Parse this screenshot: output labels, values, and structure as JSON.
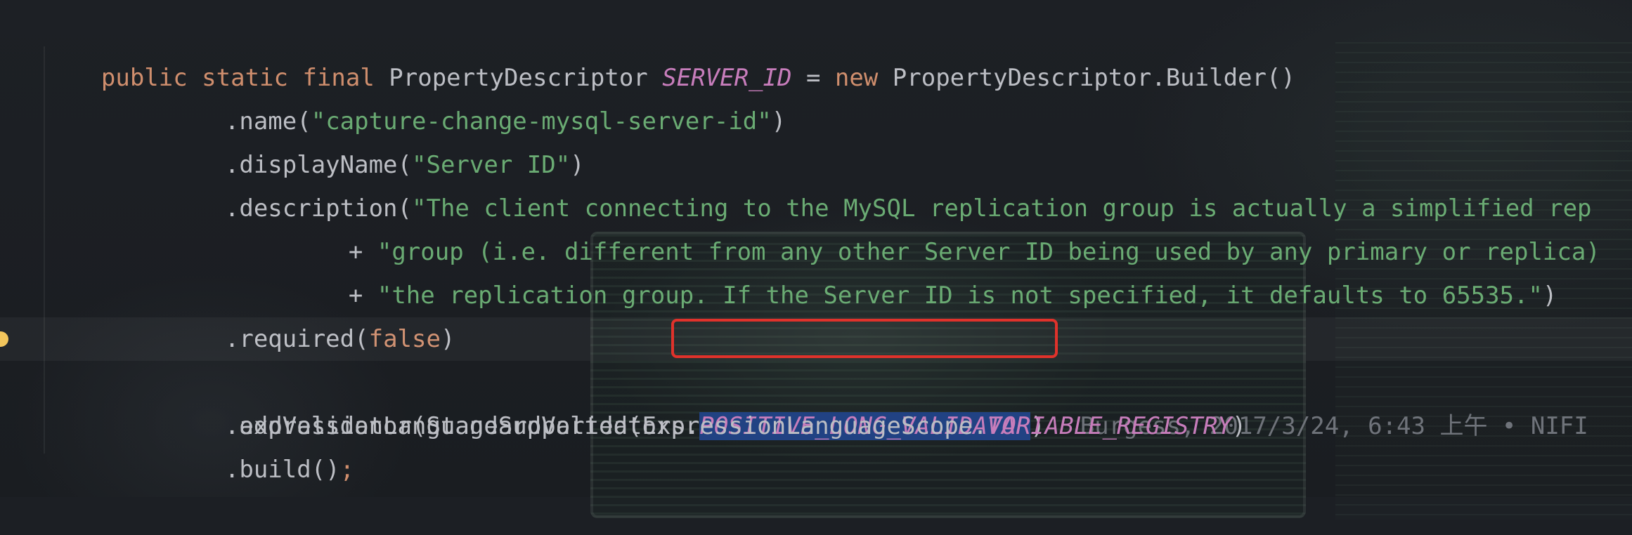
{
  "editor": {
    "lines": [
      {
        "tokens": [
          {
            "t": "public static final ",
            "c": "kw"
          },
          {
            "t": "PropertyDescriptor ",
            "c": "plain"
          },
          {
            "t": "SERVER_ID",
            "c": "field"
          },
          {
            "t": " = ",
            "c": "plain"
          },
          {
            "t": "new ",
            "c": "kw"
          },
          {
            "t": "PropertyDescriptor.Builder()",
            "c": "plain"
          }
        ]
      },
      {
        "tokens": [
          {
            "t": ".name(",
            "c": "plain"
          },
          {
            "t": "\"capture-change-mysql-server-id\"",
            "c": "str"
          },
          {
            "t": ")",
            "c": "plain"
          }
        ]
      },
      {
        "tokens": [
          {
            "t": ".displayName(",
            "c": "plain"
          },
          {
            "t": "\"Server ID\"",
            "c": "str"
          },
          {
            "t": ")",
            "c": "plain"
          }
        ]
      },
      {
        "tokens": [
          {
            "t": ".description(",
            "c": "plain"
          },
          {
            "t": "\"The client connecting to the MySQL replication group is actually a simplified rep",
            "c": "str"
          }
        ]
      },
      {
        "tokens": [
          {
            "t": "+ ",
            "c": "plain"
          },
          {
            "t": "\"group (i.e. different from any other Server ID being used by any primary or replica)",
            "c": "str"
          }
        ]
      },
      {
        "tokens": [
          {
            "t": "+ ",
            "c": "plain"
          },
          {
            "t": "\"the replication group. If the Server ID is not specified, it defaults to 65535.\"",
            "c": "str"
          },
          {
            "t": ")",
            "c": "plain"
          }
        ]
      },
      {
        "tokens": [
          {
            "t": ".required(",
            "c": "plain"
          },
          {
            "t": "false",
            "c": "kw"
          },
          {
            "t": ")",
            "c": "plain"
          }
        ]
      },
      {
        "tokens": [
          {
            "t": ".addValidator(StandardValidators.",
            "c": "plain"
          },
          {
            "t": "POSITIVE_LONG_VALIDATOR",
            "c": "selected"
          },
          {
            "t": ")",
            "c": "plain"
          }
        ],
        "blame": "Burgess, 2017/3/24, 6:43 上午 • NIFI"
      },
      {
        "tokens": [
          {
            "t": ".expressionLanguageSupported(ExpressionLanguageScope.",
            "c": "plain"
          },
          {
            "t": "VARIABLE_REGISTRY",
            "c": "field"
          },
          {
            "t": ")",
            "c": "plain"
          }
        ]
      },
      {
        "tokens": [
          {
            "t": ".build()",
            "c": "plain"
          },
          {
            "t": ";",
            "c": "kw"
          }
        ]
      }
    ]
  },
  "icons": {
    "intention_bulb": "lightbulb-icon"
  },
  "colors": {
    "keyword": "#cf8e6d",
    "field": "#c77dbb",
    "string": "#6aab73",
    "text": "#bcbec4",
    "selection": "#214283",
    "highlight_box": "#e0322b",
    "blame": "#6f737a"
  }
}
